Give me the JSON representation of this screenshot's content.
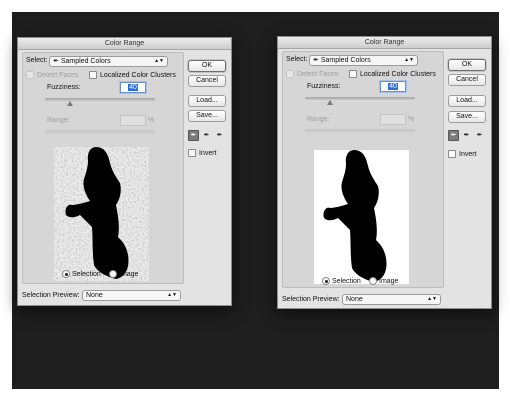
{
  "dialogs": [
    {
      "title": "Color Range",
      "select_label": "Select:",
      "select_value": "Sampled Colors",
      "detect_faces": "Detect Faces",
      "localized_color_clusters": "Localized Color Clusters",
      "fuzziness_label": "Fuzziness:",
      "fuzziness_value": "40",
      "range_label": "Range:",
      "range_unit": "%",
      "buttons": {
        "ok": "OK",
        "cancel": "Cancel",
        "load": "Load...",
        "save": "Save..."
      },
      "invert": "Invert",
      "radio_selection": "Selection",
      "radio_image": "Image",
      "preview_label": "Selection Preview:",
      "preview_value": "None",
      "preview_style": "grainy"
    },
    {
      "title": "Color Range",
      "select_label": "Select:",
      "select_value": "Sampled Colors",
      "detect_faces": "Detect Faces",
      "localized_color_clusters": "Localized Color Clusters",
      "fuzziness_label": "Fuzziness:",
      "fuzziness_value": "40",
      "range_label": "Range:",
      "range_unit": "%",
      "buttons": {
        "ok": "OK",
        "cancel": "Cancel",
        "load": "Load...",
        "save": "Save..."
      },
      "invert": "Invert",
      "radio_selection": "Selection",
      "radio_image": "Image",
      "preview_label": "Selection Preview:",
      "preview_value": "None",
      "preview_style": "clean"
    }
  ]
}
